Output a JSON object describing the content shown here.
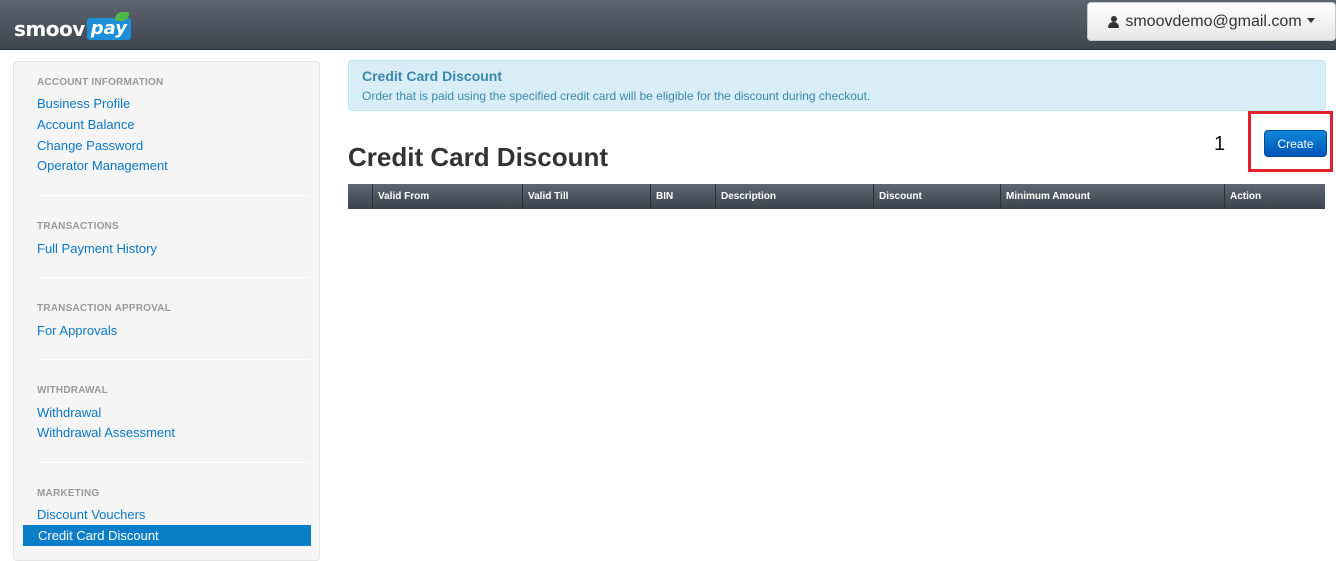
{
  "header": {
    "logo_text": "smoov",
    "logo_pay": "pay",
    "user_email": "smoovdemo@gmail.com"
  },
  "sidebar": {
    "sections": [
      {
        "title": "ACCOUNT INFORMATION",
        "items": [
          "Business Profile",
          "Account Balance",
          "Change Password",
          "Operator Management"
        ]
      },
      {
        "title": "TRANSACTIONS",
        "items": [
          "Full Payment History"
        ]
      },
      {
        "title": "TRANSACTION APPROVAL",
        "items": [
          "For Approvals"
        ]
      },
      {
        "title": "WITHDRAWAL",
        "items": [
          "Withdrawal",
          "Withdrawal Assessment"
        ]
      },
      {
        "title": "MARKETING",
        "items": [
          "Discount Vouchers",
          "Credit Card Discount"
        ]
      }
    ],
    "active_item": "Credit Card Discount"
  },
  "alert": {
    "title": "Credit Card Discount",
    "text": "Order that is paid using the specified credit card will be eligible for the discount during checkout."
  },
  "main": {
    "page_title": "Credit Card Discount",
    "step_number": "1",
    "create_label": "Create",
    "columns": [
      "",
      "Valid From",
      "Valid Till",
      "BIN",
      "Description",
      "Discount",
      "Minimum Amount",
      "Action"
    ]
  },
  "colors": {
    "accent": "#0a7ec8",
    "highlight": "#e0202a",
    "link": "#0a77c4"
  }
}
